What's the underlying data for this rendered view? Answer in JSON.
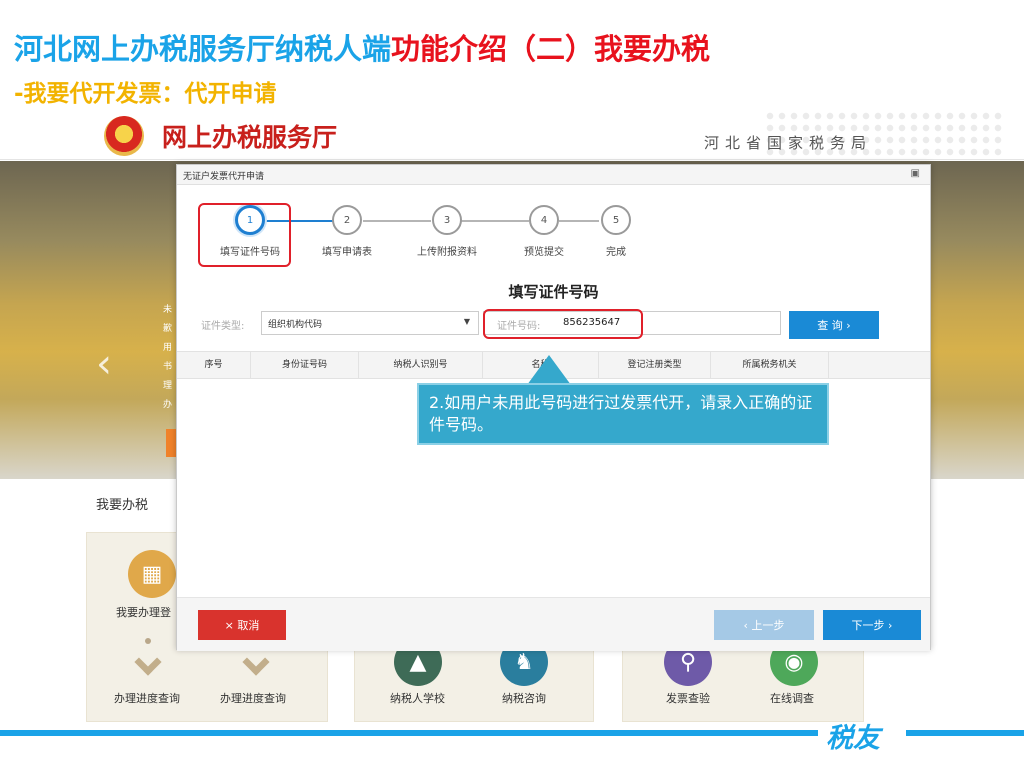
{
  "slide": {
    "title_main": "河北网上办税服务厅纳税人端",
    "title_highlight": "功能介绍（二）我要办税",
    "subtitle": "-我要代开发票：代开申请",
    "footer_brand": "税友"
  },
  "portal": {
    "logo_text": "网上办税服务厅",
    "bureau_name": "河北省国家税务局",
    "banner_side_text": [
      "未",
      "歉",
      "用",
      "书",
      "理",
      "办"
    ],
    "section_label": "我要办税",
    "tiles": [
      {
        "label": "我要办理登",
        "icon": "calendar-icon"
      },
      {
        "label": "办理进度查询",
        "icon": "chevron-down-icon"
      },
      {
        "label": "办理进度查询",
        "icon": "chevron-down-icon"
      },
      {
        "label": "纳税人学校",
        "icon": "graduation-cap-icon"
      },
      {
        "label": "纳税咨询",
        "icon": "people-icon"
      },
      {
        "label": "发票查验",
        "icon": "document-search-icon"
      },
      {
        "label": "在线调查",
        "icon": "survey-icon"
      }
    ]
  },
  "dialog": {
    "title": "无证户发票代开申请",
    "steps": [
      {
        "num": "1",
        "label": "填写证件号码",
        "active": true
      },
      {
        "num": "2",
        "label": "填写申请表",
        "active": false
      },
      {
        "num": "3",
        "label": "上传附报资料",
        "active": false
      },
      {
        "num": "4",
        "label": "预览提交",
        "active": false
      },
      {
        "num": "5",
        "label": "完成",
        "active": false
      }
    ],
    "heading": "填写证件号码",
    "id_type_label": "证件类型:",
    "id_type_value": "组织机构代码",
    "id_number_label": "证件号码:",
    "id_number_value": "856235647",
    "query_button": "查 询 ›",
    "table_headers": [
      "序号",
      "身份证号码",
      "纳税人识别号",
      "名称",
      "登记注册类型",
      "所属税务机关"
    ],
    "callout_text": "2.如用户未用此号码进行过发票代开，请录入正确的证件号码。",
    "cancel_button": "× 取消",
    "prev_button": "‹ 上一步",
    "next_button": "下一步 ›"
  },
  "colors": {
    "accent_blue": "#1aa3e8",
    "highlight_red": "#e8121d",
    "subtitle_gold": "#f2b300",
    "button_blue": "#1a8ad6",
    "cancel_red": "#d9332d",
    "callout_teal": "#35a8cc"
  }
}
